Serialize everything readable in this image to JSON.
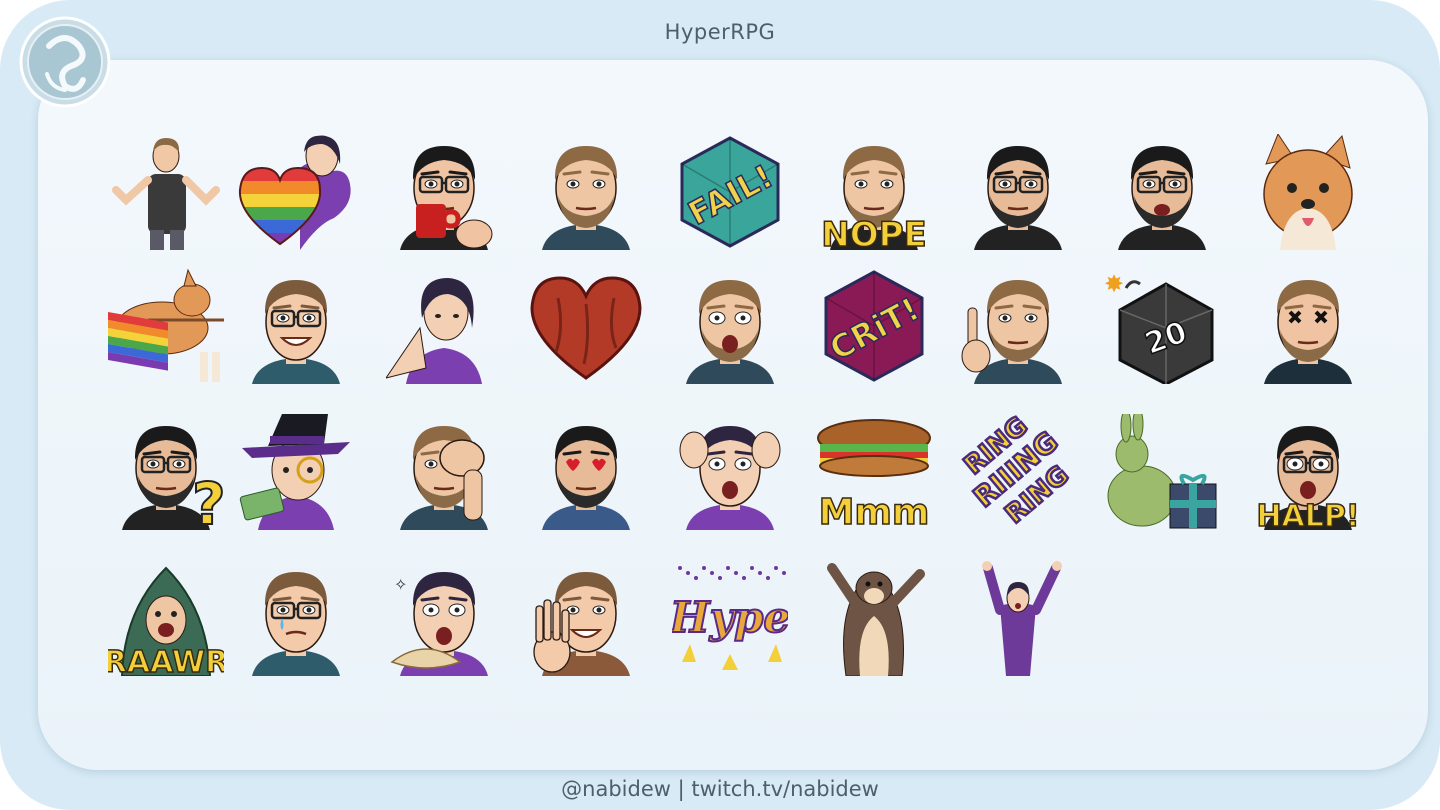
{
  "header": {
    "title": "HyperRPG"
  },
  "footer": {
    "credit": "@nabidew | twitch.tv/nabidew"
  },
  "emotes": [
    {
      "kind": "person",
      "skin": "#f0c8a6",
      "hair": "#8a6a45",
      "shirt": "#3a3a3a",
      "bg": "none",
      "pose": "shrug"
    },
    {
      "kind": "heart-rainbow",
      "skin": "#f3d0b4",
      "hair": "#2e2640",
      "shirt": "#7b3fb0"
    },
    {
      "kind": "face",
      "skin": "#f0c4a2",
      "hair": "#1a1a1a",
      "shirt": "#222222",
      "glasses": true,
      "prop": "mug"
    },
    {
      "kind": "face",
      "skin": "#efc6a4",
      "hair": "#8d6a44",
      "shirt": "#2f4a5a",
      "beard": "#8b6a48"
    },
    {
      "kind": "dice-text",
      "text": "FAIL!",
      "dice": "#3aa59a",
      "textColor": "#f0d34a"
    },
    {
      "kind": "face-text",
      "skin": "#efc6a4",
      "hair": "#8d6a44",
      "beard": "#8b6a48",
      "text": "NOPE"
    },
    {
      "kind": "face",
      "skin": "#e8bb98",
      "hair": "#1a1a1a",
      "shirt": "#222222",
      "glasses": true,
      "beard": "#2a2a2a"
    },
    {
      "kind": "face",
      "skin": "#e8bb98",
      "hair": "#1a1a1a",
      "shirt": "#222222",
      "glasses": true,
      "beard": "#2a2a2a",
      "laugh": true
    },
    {
      "kind": "dog",
      "fur": "#e29856"
    },
    {
      "kind": "dog-flag",
      "fur": "#e29856"
    },
    {
      "kind": "face",
      "skin": "#f3cbab",
      "hair": "#7c5b3c",
      "shirt": "#2f5c6b",
      "glasses": true,
      "smile": true
    },
    {
      "kind": "person",
      "skin": "#f3d0b4",
      "hair": "#2e2640",
      "shirt": "#7b3fb0",
      "pose": "pray"
    },
    {
      "kind": "heart-wood",
      "color": "#b43a28"
    },
    {
      "kind": "face",
      "skin": "#efc6a4",
      "hair": "#8d6a44",
      "shirt": "#2f4a5a",
      "beard": "#8b6a48",
      "shock": true
    },
    {
      "kind": "dice-text",
      "text": "CRiT!",
      "dice": "#8a1a55",
      "textColor": "#f0d34a"
    },
    {
      "kind": "face",
      "skin": "#efc6a4",
      "hair": "#8d6a44",
      "shirt": "#2f4a5a",
      "beard": "#8b6a48",
      "finger": true
    },
    {
      "kind": "bomb",
      "text": "20"
    },
    {
      "kind": "face",
      "skin": "#f0c4a2",
      "hair": "#8d6a44",
      "shirt": "#1d2f3a",
      "beard": "#8b6a48",
      "xeyes": true
    },
    {
      "kind": "face",
      "skin": "#e8bb98",
      "hair": "#1a1a1a",
      "shirt": "#222222",
      "glasses": true,
      "beard": "#2a2a2a",
      "question": true
    },
    {
      "kind": "witch",
      "skin": "#f3d0b4",
      "hair": "#2e2640",
      "hat": "#5a2d8a"
    },
    {
      "kind": "face",
      "skin": "#efc6a4",
      "hair": "#8d6a44",
      "shirt": "#2f4a5a",
      "beard": "#8b6a48",
      "facepalm": true
    },
    {
      "kind": "face",
      "skin": "#e8bb98",
      "hair": "#1a1a1a",
      "shirt": "#3a5a8a",
      "beard": "#2a2a2a",
      "hearteyes": true
    },
    {
      "kind": "face",
      "skin": "#f3d0b4",
      "hair": "#2e2640",
      "shirt": "#7b3fb0",
      "panic": true
    },
    {
      "kind": "sandwich-text",
      "text": "Mmm"
    },
    {
      "kind": "ring",
      "text": "RING RIIING RING"
    },
    {
      "kind": "bunny",
      "fur": "#9dbb6c",
      "box": "#3b4a6a"
    },
    {
      "kind": "face-text",
      "skin": "#e8bb98",
      "hair": "#1a1a1a",
      "glasses": true,
      "text": "HALP!",
      "shout": true
    },
    {
      "kind": "monster-text",
      "skin": "#3c6b55",
      "text": "RAAWR"
    },
    {
      "kind": "face",
      "skin": "#f3cbab",
      "hair": "#7c5b3c",
      "shirt": "#2f5c6b",
      "glasses": true,
      "tear": true
    },
    {
      "kind": "face",
      "skin": "#f3d0b4",
      "hair": "#2e2640",
      "shirt": "#7b3fb0",
      "dumpling": true
    },
    {
      "kind": "face",
      "skin": "#f3cbab",
      "hair": "#7c5b3c",
      "shirt": "#8a5a3a",
      "wave": true
    },
    {
      "kind": "hype",
      "text": "Hype"
    },
    {
      "kind": "otter",
      "fur": "#6e5444"
    },
    {
      "kind": "person",
      "skin": "#f3d0b4",
      "hair": "#2e2640",
      "shirt": "#6e3a9a",
      "pose": "cheer"
    }
  ]
}
